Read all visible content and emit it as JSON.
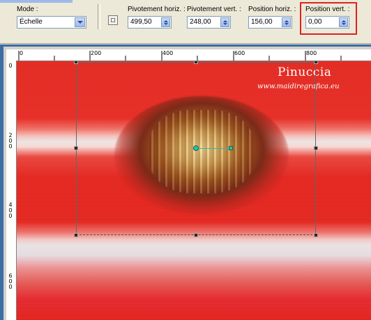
{
  "toolbar": {
    "mode": {
      "label": "Mode :",
      "value": "Échelle"
    },
    "pivot_h": {
      "label": "Pivotement horiz. :",
      "value": "499,50"
    },
    "pivot_v": {
      "label": "Pivotement vert. :",
      "value": "248,00"
    },
    "pos_h": {
      "label": "Position horiz. :",
      "value": "156,00"
    },
    "pos_v": {
      "label": "Position vert. :",
      "value": "0,00"
    },
    "highlight_color": "#e02020"
  },
  "ruler_top": {
    "labels": [
      "0",
      "200",
      "400",
      "600",
      "800"
    ]
  },
  "ruler_left": {
    "labels": [
      "0",
      "2\n0\n0",
      "4\n0\n0",
      "6\n0\n0"
    ]
  },
  "canvas": {
    "watermark_title": "Pinuccia",
    "watermark_url": "www.maidiregrafica.eu"
  },
  "icons": [
    "dropdown-arrow-icon",
    "spin-up-icon",
    "spin-down-icon",
    "pivot-tool-icon"
  ]
}
